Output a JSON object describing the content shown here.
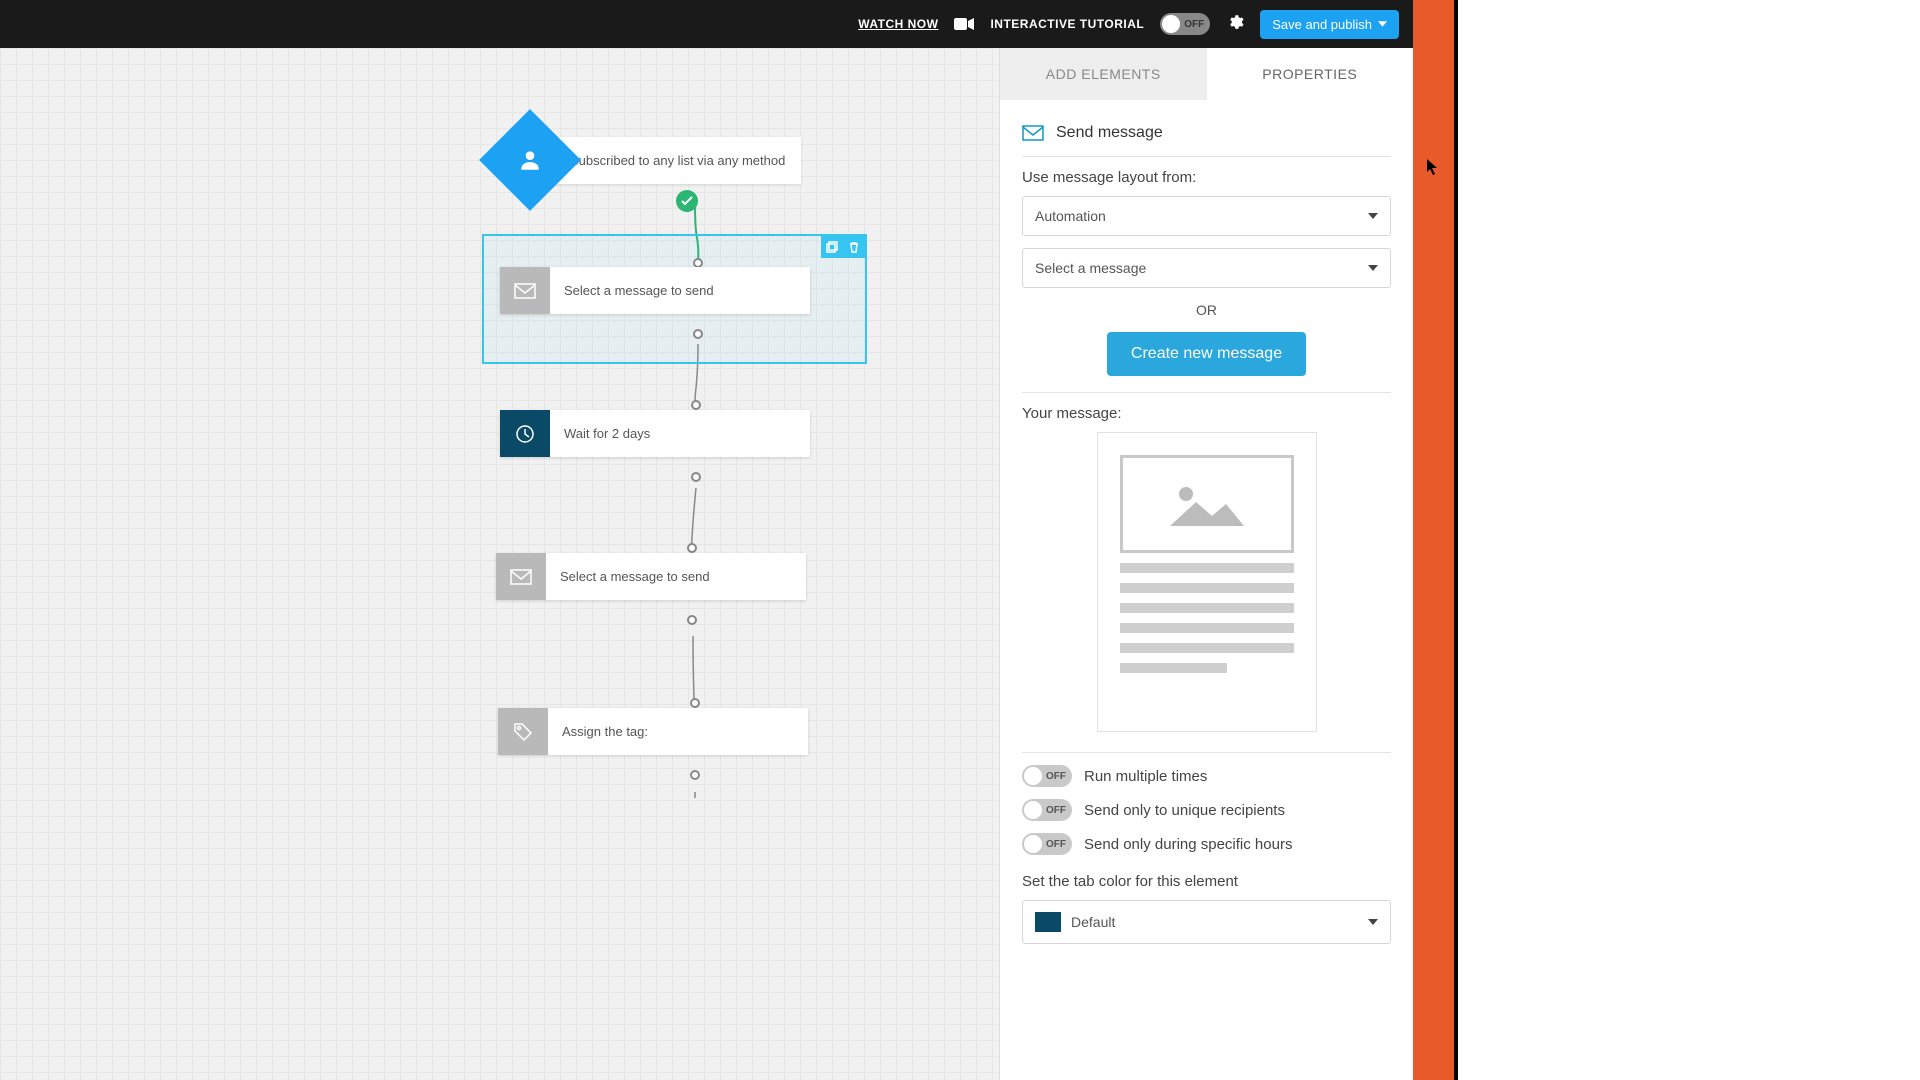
{
  "topbar": {
    "watch_label": "WATCH NOW",
    "tutorial_label": "INTERACTIVE TUTORIAL",
    "tutorial_toggle": "OFF",
    "save_label": "Save and publish"
  },
  "canvas": {
    "start_label": "Subscribed to any list via any method",
    "nodes": {
      "msg1": "Select a message to send",
      "wait": "Wait for 2 days",
      "msg2": "Select a message to send",
      "tag": "Assign the tag:"
    }
  },
  "sidebar": {
    "tabs": {
      "add": "ADD ELEMENTS",
      "props": "PROPERTIES"
    },
    "title": "Send message",
    "layout_label": "Use message layout from:",
    "layout_select": "Automation",
    "message_select": "Select a message",
    "or_label": "OR",
    "create_label": "Create new message",
    "your_message_label": "Your message:",
    "toggles": {
      "multi": {
        "state": "OFF",
        "label": "Run multiple times"
      },
      "unique": {
        "state": "OFF",
        "label": "Send only to unique recipients"
      },
      "hours": {
        "state": "OFF",
        "label": "Send only during specific hours"
      }
    },
    "color_label": "Set the tab color for this element",
    "color_value": "Default"
  }
}
